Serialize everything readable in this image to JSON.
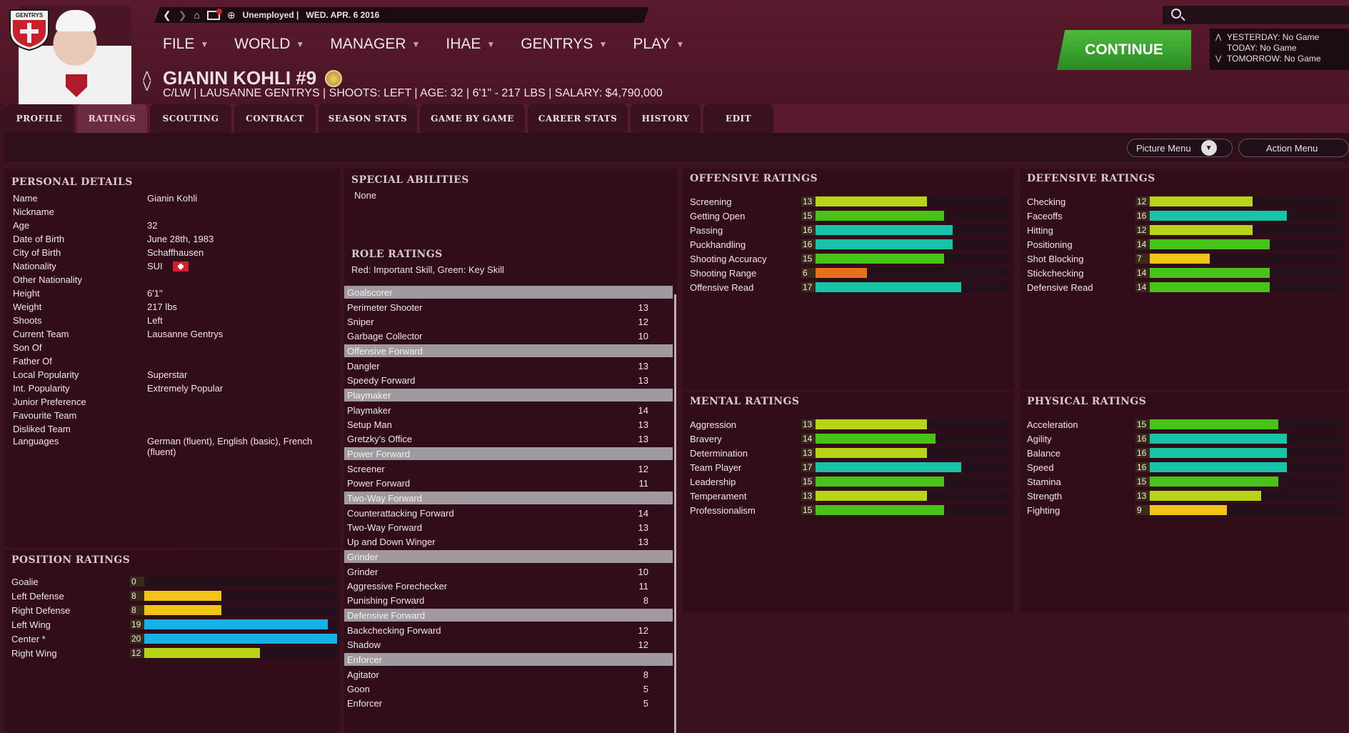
{
  "header": {
    "status": "Unemployed |",
    "date": "WED. APR. 6 2016",
    "club_crest": "GENTRYS",
    "menu": [
      {
        "label": "FILE"
      },
      {
        "label": "WORLD"
      },
      {
        "label": "MANAGER"
      },
      {
        "label": "IHAE"
      },
      {
        "label": "GENTRYS"
      },
      {
        "label": "PLAY"
      }
    ],
    "player_name": "GIANIN KOHLI #9",
    "player_info": "C/LW | LAUSANNE GENTRYS | SHOOTS: LEFT | AGE: 32 | 6'1\" - 217 LBS | SALARY: $4,790,000",
    "continue_label": "CONTINUE",
    "schedule": [
      {
        "label": "YESTERDAY: No Game"
      },
      {
        "label": "TODAY: No Game"
      },
      {
        "label": "TOMORROW: No Game"
      }
    ]
  },
  "tabs": [
    {
      "label": "PROFILE"
    },
    {
      "label": "RATINGS"
    },
    {
      "label": "SCOUTING"
    },
    {
      "label": "CONTRACT"
    },
    {
      "label": "SEASON STATS"
    },
    {
      "label": "GAME BY GAME"
    },
    {
      "label": "CAREER STATS"
    },
    {
      "label": "HISTORY"
    },
    {
      "label": "EDIT"
    }
  ],
  "subbar": {
    "picture_menu": "Picture Menu",
    "action_menu": "Action Menu"
  },
  "personal": {
    "title": "PERSONAL DETAILS",
    "rows": [
      {
        "k": "Name",
        "v": "Gianin Kohli"
      },
      {
        "k": "Nickname",
        "v": ""
      },
      {
        "k": "Age",
        "v": "32"
      },
      {
        "k": "Date of Birth",
        "v": "June 28th, 1983"
      },
      {
        "k": "City of Birth",
        "v": "Schaffhausen"
      },
      {
        "k": "Nationality",
        "v": "SUI"
      },
      {
        "k": "Other Nationality",
        "v": ""
      },
      {
        "k": "Height",
        "v": "6'1\""
      },
      {
        "k": "Weight",
        "v": "217 lbs"
      },
      {
        "k": "Shoots",
        "v": "Left"
      },
      {
        "k": "Current Team",
        "v": "Lausanne Gentrys"
      },
      {
        "k": "Son Of",
        "v": ""
      },
      {
        "k": "Father Of",
        "v": ""
      },
      {
        "k": "Local Popularity",
        "v": "Superstar"
      },
      {
        "k": "Int. Popularity",
        "v": "Extremely Popular"
      },
      {
        "k": "Junior Preference",
        "v": ""
      },
      {
        "k": "Favourite Team",
        "v": ""
      },
      {
        "k": "Disliked Team",
        "v": ""
      },
      {
        "k": "Languages",
        "v": "German (fluent), English (basic), French (fluent)"
      }
    ]
  },
  "position": {
    "title": "POSITION RATINGS",
    "rows": [
      {
        "k": "Goalie",
        "v": 0
      },
      {
        "k": "Left Defense",
        "v": 8
      },
      {
        "k": "Right Defense",
        "v": 8
      },
      {
        "k": "Left Wing",
        "v": 19
      },
      {
        "k": "Center *",
        "v": 20
      },
      {
        "k": "Right Wing",
        "v": 12
      }
    ]
  },
  "special": {
    "title": "SPECIAL ABILITIES",
    "value": "None"
  },
  "roles": {
    "title": "ROLE RATINGS",
    "legend": "Red: Important Skill, Green: Key Skill",
    "groups": [
      {
        "name": "Goalscorer",
        "items": [
          [
            "Perimeter Shooter",
            "13"
          ],
          [
            "Sniper",
            "12"
          ],
          [
            "Garbage Collector",
            "10"
          ]
        ]
      },
      {
        "name": "Offensive Forward",
        "items": [
          [
            "Dangler",
            "13"
          ],
          [
            "Speedy Forward",
            "13"
          ]
        ]
      },
      {
        "name": "Playmaker",
        "items": [
          [
            "Playmaker",
            "14"
          ],
          [
            "Setup Man",
            "13"
          ],
          [
            "Gretzky's Office",
            "13"
          ]
        ]
      },
      {
        "name": "Power Forward",
        "items": [
          [
            "Screener",
            "12"
          ],
          [
            "Power Forward",
            "11"
          ]
        ]
      },
      {
        "name": "Two-Way Forward",
        "items": [
          [
            "Counterattacking Forward",
            "14"
          ],
          [
            "Two-Way Forward",
            "13"
          ],
          [
            "Up and Down Winger",
            "13"
          ]
        ]
      },
      {
        "name": "Grinder",
        "items": [
          [
            "Grinder",
            "10"
          ],
          [
            "Aggressive Forechecker",
            "11"
          ],
          [
            "Punishing Forward",
            "8"
          ]
        ]
      },
      {
        "name": "Defensive Forward",
        "items": [
          [
            "Backchecking Forward",
            "12"
          ],
          [
            "Shadow",
            "12"
          ]
        ]
      },
      {
        "name": "Enforcer",
        "items": [
          [
            "Agitator",
            "8"
          ],
          [
            "Goon",
            "5"
          ],
          [
            "Enforcer",
            "5"
          ]
        ]
      }
    ]
  },
  "offensive": {
    "title": "OFFENSIVE RATINGS",
    "rows": [
      [
        "Screening",
        13
      ],
      [
        "Getting Open",
        15
      ],
      [
        "Passing",
        16
      ],
      [
        "Puckhandling",
        16
      ],
      [
        "Shooting Accuracy",
        15
      ],
      [
        "Shooting Range",
        6
      ],
      [
        "Offensive Read",
        17
      ]
    ]
  },
  "defensive": {
    "title": "DEFENSIVE RATINGS",
    "rows": [
      [
        "Checking",
        12
      ],
      [
        "Faceoffs",
        16
      ],
      [
        "Hitting",
        12
      ],
      [
        "Positioning",
        14
      ],
      [
        "Shot Blocking",
        7
      ],
      [
        "Stickchecking",
        14
      ],
      [
        "Defensive Read",
        14
      ]
    ]
  },
  "mental": {
    "title": "MENTAL RATINGS",
    "rows": [
      [
        "Aggression",
        13
      ],
      [
        "Bravery",
        14
      ],
      [
        "Determination",
        13
      ],
      [
        "Team Player",
        17
      ],
      [
        "Leadership",
        15
      ],
      [
        "Temperament",
        13
      ],
      [
        "Professionalism",
        15
      ]
    ]
  },
  "physical": {
    "title": "PHYSICAL RATINGS",
    "rows": [
      [
        "Acceleration",
        15
      ],
      [
        "Agility",
        16
      ],
      [
        "Balance",
        16
      ],
      [
        "Speed",
        16
      ],
      [
        "Stamina",
        15
      ],
      [
        "Strength",
        13
      ],
      [
        "Fighting",
        9
      ]
    ]
  },
  "colors": {
    "tier_low": "#e8701a",
    "tier_mid_low": "#f2c418",
    "tier_mid": "#b8d418",
    "tier_high": "#48c418",
    "tier_top": "#18c4a8",
    "tier_max": "#18b0e8"
  }
}
